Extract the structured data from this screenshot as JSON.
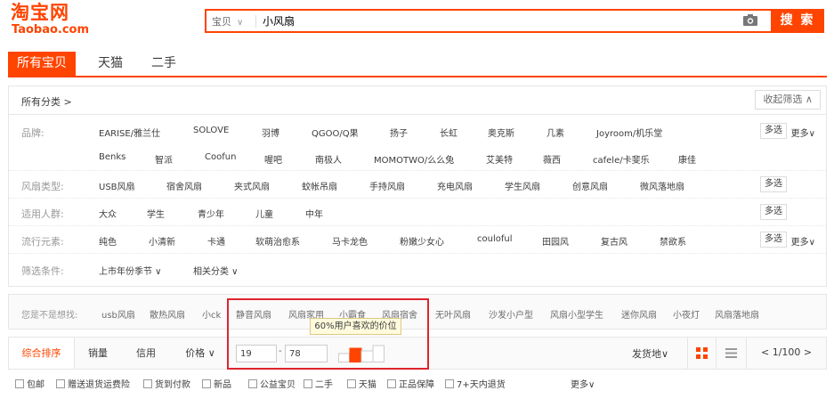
{
  "logo": {
    "cn": "淘宝网",
    "en": "Taobao.com"
  },
  "search": {
    "category": "宝贝",
    "query": "小风扇",
    "button": "搜 索"
  },
  "tabs": [
    "所有宝贝",
    "天猫",
    "二手"
  ],
  "crumb": "所有分类 >",
  "collapse_label": "收起筛选 ∧",
  "filters": {
    "brand": {
      "label": "品牌:",
      "row1": [
        "EARISE/雅兰仕",
        "SOLOVE",
        "羽博",
        "QGOO/Q果",
        "扬子",
        "长虹",
        "奥克斯",
        "几素",
        "Joyroom/机乐堂"
      ],
      "row2": [
        "Benks",
        "智派",
        "Coofun",
        "喔吧",
        "南极人",
        "MOMOTWO/么么兔",
        "艾美特",
        "薇西",
        "cafele/卡斐乐",
        "康佳"
      ],
      "multi": "多选",
      "more": "更多∨"
    },
    "type": {
      "label": "风扇类型:",
      "values": [
        "USB风扇",
        "宿舍风扇",
        "夹式风扇",
        "蚊帐吊扇",
        "手持风扇",
        "充电风扇",
        "学生风扇",
        "创意风扇",
        "微风落地扇"
      ],
      "multi": "多选"
    },
    "crowd": {
      "label": "适用人群:",
      "values": [
        "大众",
        "学生",
        "青少年",
        "儿童",
        "中年"
      ],
      "multi": "多选"
    },
    "style": {
      "label": "流行元素:",
      "values": [
        "纯色",
        "小清新",
        "卡通",
        "软萌治愈系",
        "马卡龙色",
        "粉嫩少女心",
        "couloful",
        "田园风",
        "复古风",
        "禁欲系"
      ],
      "multi": "多选",
      "more": "更多∨"
    },
    "conditions": {
      "label": "筛选条件:",
      "values": [
        "上市年份季节 ∨",
        "相关分类 ∨"
      ]
    }
  },
  "suggest": {
    "label": "您是不是想找:",
    "items": [
      "usb风扇",
      "散热风扇",
      "小ck",
      "静音风扇",
      "风扇家用",
      "小霸食",
      "风扇宿舍",
      "无叶风扇",
      "沙发小户型",
      "风扇小型学生",
      "迷你风扇",
      "小夜灯",
      "风扇落地扇"
    ]
  },
  "sort": {
    "items": [
      "综合排序",
      "销量",
      "信用",
      "价格 ∨"
    ],
    "price_min": "19",
    "price_sep": "-",
    "price_max": "78",
    "tooltip": "60%用户喜欢的价位",
    "ship": "发货地∨",
    "pager": "<  1/100  >"
  },
  "checks": [
    "包邮",
    "赠送退货运费险",
    "货到付款",
    "新品",
    "公益宝贝",
    "二手",
    "天猫",
    "正品保障",
    "7+天内退货"
  ],
  "checks_more": "更多∨",
  "colors": {
    "accent": "#ff4400",
    "highlight": "#e0242d"
  }
}
